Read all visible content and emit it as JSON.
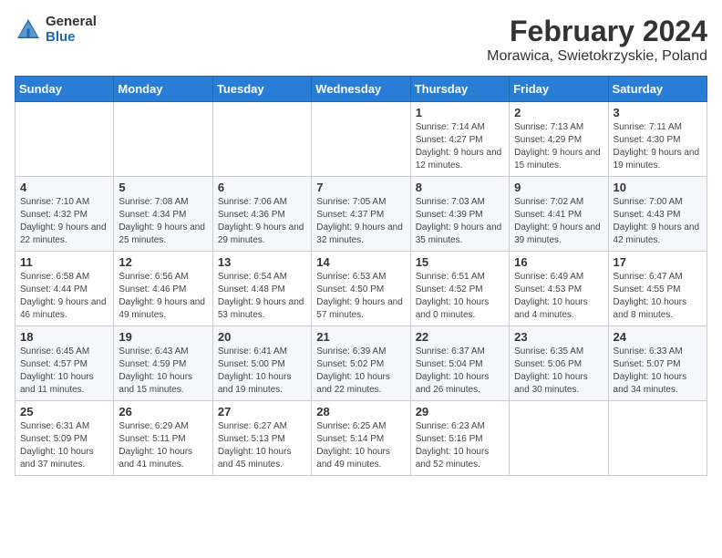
{
  "logo": {
    "general": "General",
    "blue": "Blue"
  },
  "title": {
    "month_year": "February 2024",
    "location": "Morawica, Swietokrzyskie, Poland"
  },
  "weekdays": [
    "Sunday",
    "Monday",
    "Tuesday",
    "Wednesday",
    "Thursday",
    "Friday",
    "Saturday"
  ],
  "weeks": [
    [
      {
        "day": "",
        "sunrise": "",
        "sunset": "",
        "daylight": ""
      },
      {
        "day": "",
        "sunrise": "",
        "sunset": "",
        "daylight": ""
      },
      {
        "day": "",
        "sunrise": "",
        "sunset": "",
        "daylight": ""
      },
      {
        "day": "",
        "sunrise": "",
        "sunset": "",
        "daylight": ""
      },
      {
        "day": "1",
        "sunrise": "Sunrise: 7:14 AM",
        "sunset": "Sunset: 4:27 PM",
        "daylight": "Daylight: 9 hours and 12 minutes."
      },
      {
        "day": "2",
        "sunrise": "Sunrise: 7:13 AM",
        "sunset": "Sunset: 4:29 PM",
        "daylight": "Daylight: 9 hours and 15 minutes."
      },
      {
        "day": "3",
        "sunrise": "Sunrise: 7:11 AM",
        "sunset": "Sunset: 4:30 PM",
        "daylight": "Daylight: 9 hours and 19 minutes."
      }
    ],
    [
      {
        "day": "4",
        "sunrise": "Sunrise: 7:10 AM",
        "sunset": "Sunset: 4:32 PM",
        "daylight": "Daylight: 9 hours and 22 minutes."
      },
      {
        "day": "5",
        "sunrise": "Sunrise: 7:08 AM",
        "sunset": "Sunset: 4:34 PM",
        "daylight": "Daylight: 9 hours and 25 minutes."
      },
      {
        "day": "6",
        "sunrise": "Sunrise: 7:06 AM",
        "sunset": "Sunset: 4:36 PM",
        "daylight": "Daylight: 9 hours and 29 minutes."
      },
      {
        "day": "7",
        "sunrise": "Sunrise: 7:05 AM",
        "sunset": "Sunset: 4:37 PM",
        "daylight": "Daylight: 9 hours and 32 minutes."
      },
      {
        "day": "8",
        "sunrise": "Sunrise: 7:03 AM",
        "sunset": "Sunset: 4:39 PM",
        "daylight": "Daylight: 9 hours and 35 minutes."
      },
      {
        "day": "9",
        "sunrise": "Sunrise: 7:02 AM",
        "sunset": "Sunset: 4:41 PM",
        "daylight": "Daylight: 9 hours and 39 minutes."
      },
      {
        "day": "10",
        "sunrise": "Sunrise: 7:00 AM",
        "sunset": "Sunset: 4:43 PM",
        "daylight": "Daylight: 9 hours and 42 minutes."
      }
    ],
    [
      {
        "day": "11",
        "sunrise": "Sunrise: 6:58 AM",
        "sunset": "Sunset: 4:44 PM",
        "daylight": "Daylight: 9 hours and 46 minutes."
      },
      {
        "day": "12",
        "sunrise": "Sunrise: 6:56 AM",
        "sunset": "Sunset: 4:46 PM",
        "daylight": "Daylight: 9 hours and 49 minutes."
      },
      {
        "day": "13",
        "sunrise": "Sunrise: 6:54 AM",
        "sunset": "Sunset: 4:48 PM",
        "daylight": "Daylight: 9 hours and 53 minutes."
      },
      {
        "day": "14",
        "sunrise": "Sunrise: 6:53 AM",
        "sunset": "Sunset: 4:50 PM",
        "daylight": "Daylight: 9 hours and 57 minutes."
      },
      {
        "day": "15",
        "sunrise": "Sunrise: 6:51 AM",
        "sunset": "Sunset: 4:52 PM",
        "daylight": "Daylight: 10 hours and 0 minutes."
      },
      {
        "day": "16",
        "sunrise": "Sunrise: 6:49 AM",
        "sunset": "Sunset: 4:53 PM",
        "daylight": "Daylight: 10 hours and 4 minutes."
      },
      {
        "day": "17",
        "sunrise": "Sunrise: 6:47 AM",
        "sunset": "Sunset: 4:55 PM",
        "daylight": "Daylight: 10 hours and 8 minutes."
      }
    ],
    [
      {
        "day": "18",
        "sunrise": "Sunrise: 6:45 AM",
        "sunset": "Sunset: 4:57 PM",
        "daylight": "Daylight: 10 hours and 11 minutes."
      },
      {
        "day": "19",
        "sunrise": "Sunrise: 6:43 AM",
        "sunset": "Sunset: 4:59 PM",
        "daylight": "Daylight: 10 hours and 15 minutes."
      },
      {
        "day": "20",
        "sunrise": "Sunrise: 6:41 AM",
        "sunset": "Sunset: 5:00 PM",
        "daylight": "Daylight: 10 hours and 19 minutes."
      },
      {
        "day": "21",
        "sunrise": "Sunrise: 6:39 AM",
        "sunset": "Sunset: 5:02 PM",
        "daylight": "Daylight: 10 hours and 22 minutes."
      },
      {
        "day": "22",
        "sunrise": "Sunrise: 6:37 AM",
        "sunset": "Sunset: 5:04 PM",
        "daylight": "Daylight: 10 hours and 26 minutes."
      },
      {
        "day": "23",
        "sunrise": "Sunrise: 6:35 AM",
        "sunset": "Sunset: 5:06 PM",
        "daylight": "Daylight: 10 hours and 30 minutes."
      },
      {
        "day": "24",
        "sunrise": "Sunrise: 6:33 AM",
        "sunset": "Sunset: 5:07 PM",
        "daylight": "Daylight: 10 hours and 34 minutes."
      }
    ],
    [
      {
        "day": "25",
        "sunrise": "Sunrise: 6:31 AM",
        "sunset": "Sunset: 5:09 PM",
        "daylight": "Daylight: 10 hours and 37 minutes."
      },
      {
        "day": "26",
        "sunrise": "Sunrise: 6:29 AM",
        "sunset": "Sunset: 5:11 PM",
        "daylight": "Daylight: 10 hours and 41 minutes."
      },
      {
        "day": "27",
        "sunrise": "Sunrise: 6:27 AM",
        "sunset": "Sunset: 5:13 PM",
        "daylight": "Daylight: 10 hours and 45 minutes."
      },
      {
        "day": "28",
        "sunrise": "Sunrise: 6:25 AM",
        "sunset": "Sunset: 5:14 PM",
        "daylight": "Daylight: 10 hours and 49 minutes."
      },
      {
        "day": "29",
        "sunrise": "Sunrise: 6:23 AM",
        "sunset": "Sunset: 5:16 PM",
        "daylight": "Daylight: 10 hours and 52 minutes."
      },
      {
        "day": "",
        "sunrise": "",
        "sunset": "",
        "daylight": ""
      },
      {
        "day": "",
        "sunrise": "",
        "sunset": "",
        "daylight": ""
      }
    ]
  ]
}
